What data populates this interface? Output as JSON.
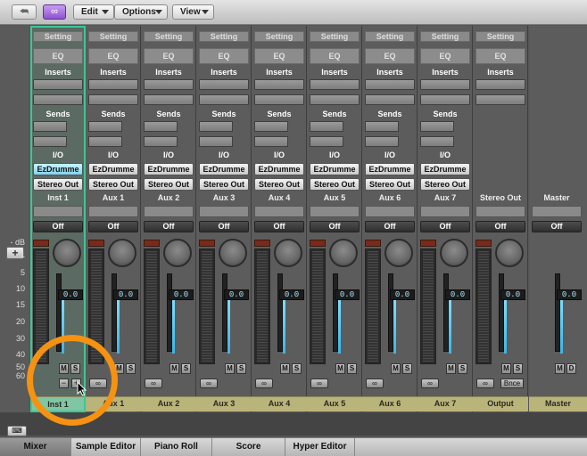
{
  "toolbar": {
    "back_icon": "back-arrow",
    "link_icon": "link-chain",
    "menus": [
      "Edit",
      "Options",
      "View"
    ]
  },
  "left_scale": {
    "labels": [
      "- dB",
      "1",
      "5",
      "10",
      "15",
      "20",
      "30",
      "40",
      "50",
      "60"
    ]
  },
  "strip_labels": {
    "setting": "Setting",
    "eq": "EQ",
    "inserts": "Inserts",
    "sends": "Sends",
    "io": "I/O",
    "off": "Off",
    "volume": "0.0",
    "mute": "M",
    "solo": "S",
    "dim": "D",
    "bounce": "Bnce"
  },
  "channels": [
    {
      "name": "Inst 1",
      "input": "EzDrumme",
      "output": "Stereo Out",
      "tag": "Inst 1",
      "tag_num": "1",
      "selected": true
    },
    {
      "name": "Aux 1",
      "input": "EzDrumme",
      "output": "Stereo Out",
      "tag": "Aux 1"
    },
    {
      "name": "Aux 2",
      "input": "EzDrumme",
      "output": "Stereo Out",
      "tag": "Aux 2"
    },
    {
      "name": "Aux 3",
      "input": "EzDrumme",
      "output": "Stereo Out",
      "tag": "Aux 3"
    },
    {
      "name": "Aux 4",
      "input": "EzDrumme",
      "output": "Stereo Out",
      "tag": "Aux 4"
    },
    {
      "name": "Aux 5",
      "input": "EzDrumme",
      "output": "Stereo Out",
      "tag": "Aux 5"
    },
    {
      "name": "Aux 6",
      "input": "EzDrumme",
      "output": "Stereo Out",
      "tag": "Aux 6"
    },
    {
      "name": "Aux 7",
      "input": "EzDrumme",
      "output": "Stereo Out",
      "tag": "Aux 7"
    }
  ],
  "output_channel": {
    "name": "Stereo Out",
    "tag": "Output"
  },
  "master_channel": {
    "name": "Master",
    "tag": "Master"
  },
  "tabs": [
    "Mixer",
    "Sample Editor",
    "Piano Roll",
    "Score",
    "Hyper Editor"
  ],
  "active_tab": "Mixer",
  "highlight_color": "#f59211",
  "selection_color": "#3cc796"
}
